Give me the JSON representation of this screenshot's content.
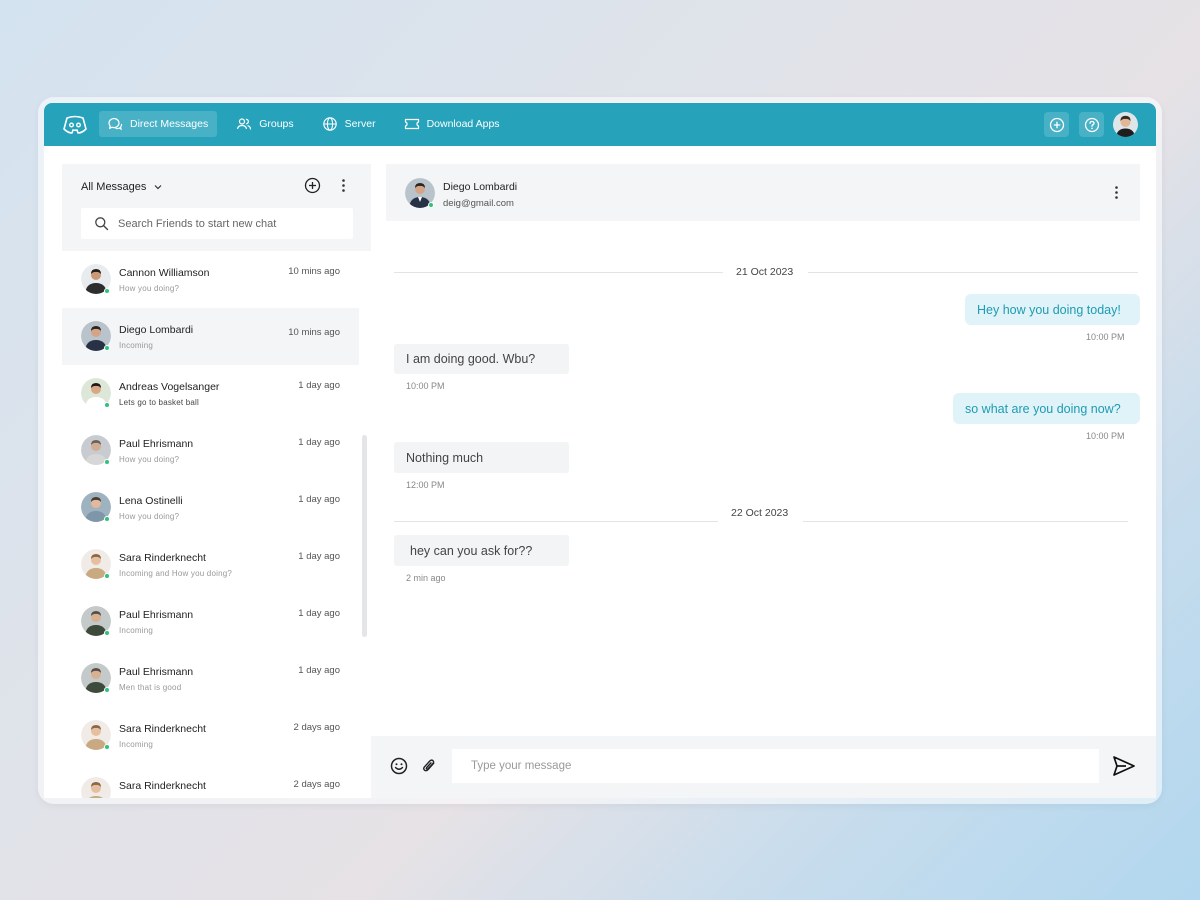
{
  "nav": {
    "items": [
      {
        "label": "Direct Messages",
        "icon": "chat-bubbles-icon",
        "active": true
      },
      {
        "label": "Groups",
        "icon": "users-icon"
      },
      {
        "label": "Server",
        "icon": "globe-icon"
      },
      {
        "label": "Download Apps",
        "icon": "ticket-icon"
      }
    ]
  },
  "sidebar": {
    "filter_label": "All Messages",
    "search_placeholder": "Search Friends to start new chat",
    "contacts": [
      {
        "name": "Cannon Williamson",
        "preview": "How you doing?",
        "time": "10 mins ago"
      },
      {
        "name": "Diego Lombardi",
        "preview": "Incoming",
        "time": "10 mins ago",
        "active": true
      },
      {
        "name": "Andreas Vogelsanger",
        "preview": "Lets go to basket ball",
        "time": "1 day ago"
      },
      {
        "name": "Paul Ehrismann",
        "preview": "How you doing?",
        "time": "1 day ago"
      },
      {
        "name": "Lena Ostinelli",
        "preview": "How you doing?",
        "time": "1 day ago"
      },
      {
        "name": "Sara Rinderknecht",
        "preview": "Incoming and How you doing?",
        "time": "1 day ago"
      },
      {
        "name": "Paul Ehrismann",
        "preview": "Incoming",
        "time": "1 day ago"
      },
      {
        "name": "Paul Ehrismann",
        "preview": "Men that is good",
        "time": "1 day ago"
      },
      {
        "name": "Sara Rinderknecht",
        "preview": "Incoming",
        "time": "2 days ago"
      },
      {
        "name": "Sara Rinderknecht",
        "preview": "",
        "time": "2 days ago"
      }
    ]
  },
  "chat": {
    "contact_name": "Diego Lombardi",
    "contact_email": "deig@gmail.com",
    "dates": [
      "21 Oct 2023",
      "22 Oct 2023"
    ],
    "messages": [
      {
        "text": "Hey how you doing today!",
        "time": "10:00 PM",
        "direction": "out"
      },
      {
        "text": "I am doing good. Wbu?",
        "time": "10:00 PM",
        "direction": "in"
      },
      {
        "text": "so what are you doing now?",
        "time": "10:00 PM",
        "direction": "out"
      },
      {
        "text": "Nothing much",
        "time": "12:00 PM",
        "direction": "in"
      },
      {
        "text": "hey can you ask for??",
        "time": "2 min ago",
        "direction": "in"
      }
    ]
  },
  "composer": {
    "placeholder": "Type your message"
  },
  "colors": {
    "brand": "#26a3bb",
    "online": "#2ec27e",
    "outgoing_bubble": "#dff3f8",
    "incoming_bubble": "#f3f4f6"
  }
}
